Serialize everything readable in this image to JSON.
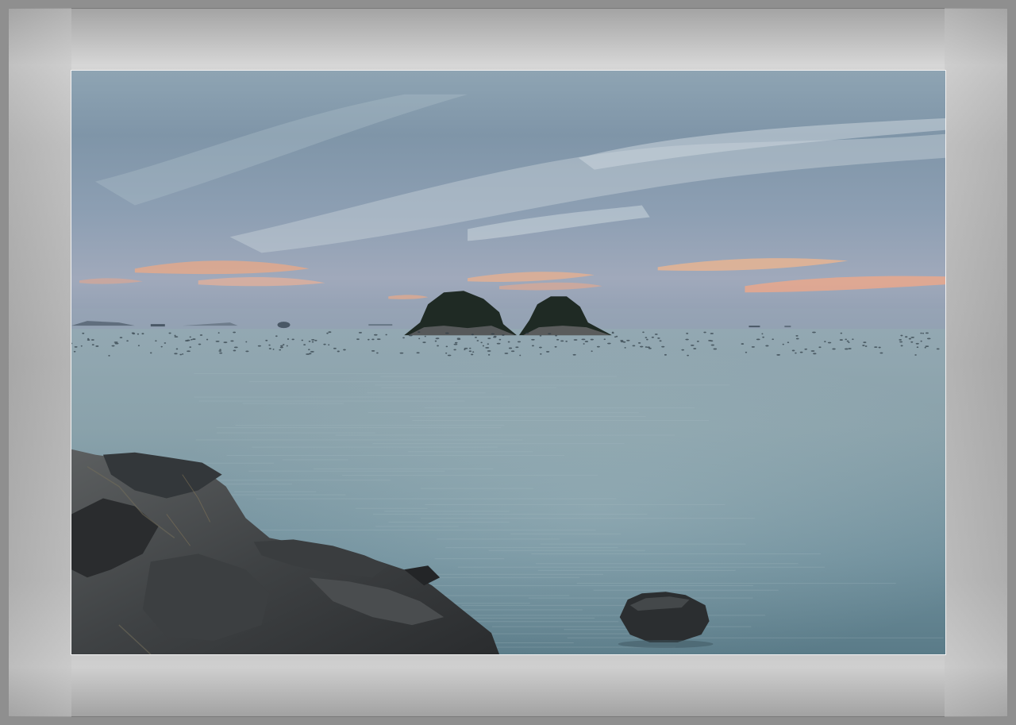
{
  "image": {
    "description_colors": {
      "sky_top": "#7f97a8",
      "sky_mid": "#9db2c0",
      "sky_horizon": "#8fa0b2",
      "sunset_glow": "#e6a98a",
      "sea_far": "#8ca3ab",
      "sea_near": "#5f7f8c",
      "rock_dark": "#2b2e30",
      "rock_mid": "#55585a",
      "island_foliage": "#1f2a24"
    }
  }
}
